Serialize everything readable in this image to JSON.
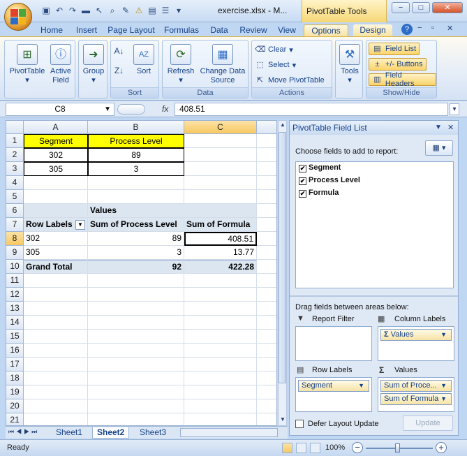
{
  "window": {
    "title": "exercise.xlsx - M...",
    "context_tools": "PivotTable Tools",
    "minimize": "−",
    "maximize": "□",
    "close": "✕"
  },
  "tabs": [
    "Home",
    "Insert",
    "Page Layout",
    "Formulas",
    "Data",
    "Review",
    "View",
    "Options",
    "Design"
  ],
  "active_tab": "Options",
  "ribbon": {
    "pivottable": "PivotTable",
    "active_field": "Active Field",
    "group_btn": "Group",
    "sort_label": "Sort",
    "sort_group": "Sort",
    "refresh": "Refresh",
    "change_source": "Change Data Source",
    "data_group": "Data",
    "clear": "Clear",
    "select": "Select",
    "move": "Move PivotTable",
    "actions_group": "Actions",
    "tools": "Tools",
    "field_list": "Field List",
    "buttons": "+/- Buttons",
    "field_headers": "Field Headers",
    "showhide_group": "Show/Hide"
  },
  "formula_bar": {
    "cell_ref": "C8",
    "fx": "fx",
    "value": "408.51"
  },
  "grid": {
    "columns": [
      "A",
      "B",
      "C"
    ],
    "rows": [
      "1",
      "2",
      "3",
      "4",
      "5",
      "6",
      "7",
      "8",
      "9",
      "10",
      "11",
      "12",
      "13",
      "14",
      "15",
      "16",
      "17",
      "18",
      "19",
      "20",
      "21"
    ],
    "source_headers": [
      "Segment",
      "Process Level"
    ],
    "source_rows": [
      [
        "302",
        "89"
      ],
      [
        "305",
        "3"
      ]
    ],
    "pivot": {
      "values_label": "Values",
      "row_labels": "Row Labels",
      "col1": "Sum of Process Level",
      "col2": "Sum of Formula",
      "rows": [
        {
          "label": "302",
          "v1": "89",
          "v2": "408.51"
        },
        {
          "label": "305",
          "v1": "3",
          "v2": "13.77"
        }
      ],
      "grand_total": {
        "label": "Grand Total",
        "v1": "92",
        "v2": "422.28"
      }
    }
  },
  "sheets": [
    "Sheet1",
    "Sheet2",
    "Sheet3"
  ],
  "active_sheet": "Sheet2",
  "status": {
    "ready": "Ready",
    "zoom": "100%"
  },
  "field_list": {
    "title": "PivotTable Field List",
    "choose": "Choose fields to add to report:",
    "fields": [
      "Segment",
      "Process Level",
      "Formula"
    ],
    "drag": "Drag fields between areas below:",
    "report_filter": "Report Filter",
    "column_labels": "Column Labels",
    "row_labels": "Row Labels",
    "values": "Values",
    "col_values_chip": "Values",
    "row_chip": "Segment",
    "value_chips": [
      "Sum of Proce...",
      "Sum of Formula"
    ],
    "defer": "Defer Layout Update",
    "update": "Update"
  }
}
